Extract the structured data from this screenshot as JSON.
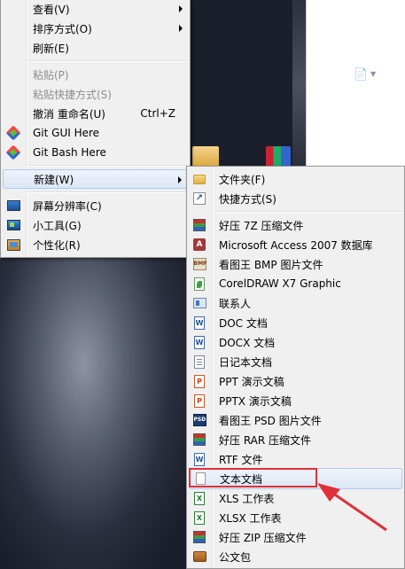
{
  "context_menu": {
    "items": [
      {
        "label": "查看(V)",
        "has_submenu": true,
        "enabled": true
      },
      {
        "label": "排序方式(O)",
        "has_submenu": true,
        "enabled": true
      },
      {
        "label": "刷新(E)",
        "enabled": true
      },
      {
        "label": "粘贴(P)",
        "enabled": false
      },
      {
        "label": "粘贴快捷方式(S)",
        "enabled": false
      },
      {
        "label": "撤消 重命名(U)",
        "shortcut": "Ctrl+Z",
        "enabled": true
      },
      {
        "label": "Git GUI Here",
        "icon": "git-icon",
        "enabled": true
      },
      {
        "label": "Git Bash Here",
        "icon": "git-icon",
        "enabled": true
      },
      {
        "label": "新建(W)",
        "has_submenu": true,
        "enabled": true,
        "hover": true
      },
      {
        "label": "屏幕分辨率(C)",
        "icon": "screen-resolution-icon",
        "enabled": true
      },
      {
        "label": "小工具(G)",
        "icon": "gadgets-icon",
        "enabled": true
      },
      {
        "label": "个性化(R)",
        "icon": "personalize-icon",
        "enabled": true
      }
    ]
  },
  "new_submenu": {
    "items": [
      {
        "label": "文件夹(F)",
        "icon": "folder-icon"
      },
      {
        "label": "快捷方式(S)",
        "icon": "shortcut-icon"
      },
      {
        "label": "好压 7Z 压缩文件",
        "icon": "archive-icon"
      },
      {
        "label": "Microsoft Access 2007 数据库",
        "icon": "access-icon"
      },
      {
        "label": "看图王 BMP 图片文件",
        "icon": "bmp-icon"
      },
      {
        "label": "CorelDRAW X7 Graphic",
        "icon": "coreldraw-icon"
      },
      {
        "label": "联系人",
        "icon": "contact-icon"
      },
      {
        "label": "DOC 文档",
        "icon": "doc-icon"
      },
      {
        "label": "DOCX 文档",
        "icon": "docx-icon"
      },
      {
        "label": "日记本文档",
        "icon": "journal-icon"
      },
      {
        "label": "PPT 演示文稿",
        "icon": "ppt-icon"
      },
      {
        "label": "PPTX 演示文稿",
        "icon": "pptx-icon"
      },
      {
        "label": "看图王 PSD 图片文件",
        "icon": "psd-icon"
      },
      {
        "label": "好压 RAR 压缩文件",
        "icon": "archive-icon"
      },
      {
        "label": "RTF 文件",
        "icon": "rtf-icon"
      },
      {
        "label": "文本文档",
        "icon": "text-file-icon",
        "highlighted": true
      },
      {
        "label": "XLS 工作表",
        "icon": "xls-icon"
      },
      {
        "label": "XLSX 工作表",
        "icon": "xlsx-icon"
      },
      {
        "label": "好压 ZIP 压缩文件",
        "icon": "archive-icon"
      },
      {
        "label": "公文包",
        "icon": "briefcase-icon"
      }
    ]
  },
  "colors": {
    "menu_bg": "#f0f0f0",
    "hover_border": "#aecbf0",
    "annotation_red": "#e0303a",
    "disabled_text": "#8d8d8d"
  }
}
